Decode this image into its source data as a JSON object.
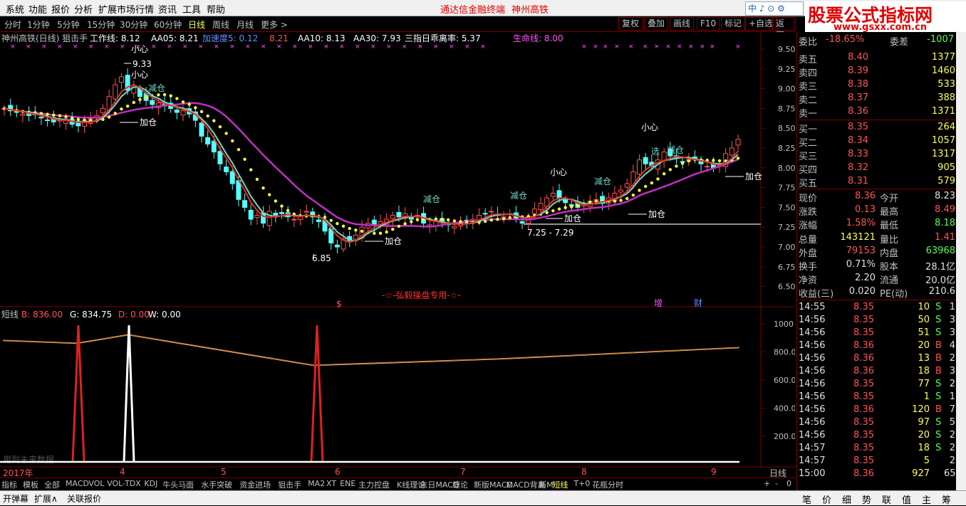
{
  "menu": {
    "items": [
      "系统",
      "功能",
      "报价",
      "分析",
      "扩展市场行情",
      "资讯",
      "工具",
      "帮助"
    ],
    "brand": "通达信金融终端",
    "stock_title": "神州高铁"
  },
  "watermark": {
    "title": "股票公式指标网",
    "url": "www.gsxx.com.cn"
  },
  "ime": {
    "text": "中 ♪ ⊙ ⚙"
  },
  "periods": {
    "items": [
      "分时",
      "1分钟",
      "5分钟",
      "15分钟",
      "30分钟",
      "60分钟",
      "日线",
      "周线",
      "月线",
      "更多 >"
    ],
    "active": "日线"
  },
  "toolbar": {
    "buttons": [
      "复权",
      "叠加",
      "画线",
      "F10",
      "标记",
      "+自选",
      "返回"
    ]
  },
  "indicator_line": {
    "title": "神州高铁(日线) 狙击手",
    "items": [
      {
        "label": "工作线: 8.12",
        "color": "#ffffff"
      },
      {
        "label": "AA05: 8.21",
        "color": "#ffffff"
      },
      {
        "label": "加速度5: 0.12",
        "color": "#5f8fff"
      },
      {
        "label": "8.21",
        "color": "#ff5454"
      },
      {
        "label": "AA10: 8.13",
        "color": "#ffffff"
      },
      {
        "label": "AA30: 7.93",
        "color": "#ffffff"
      },
      {
        "label": "三指日乖离率: 5.37",
        "color": "#ffffff"
      },
      {
        "label": "生命线: 8.00",
        "color": "#ff54ff"
      }
    ]
  },
  "price_axis": [
    "9.50",
    "9.25",
    "9.00",
    "8.75",
    "8.50",
    "8.25",
    "8.00",
    "7.75",
    "7.50",
    "7.25",
    "7.00",
    "6.75",
    "6.50"
  ],
  "annotations": {
    "high_label": "9.33",
    "low_label": "6.85",
    "range_label": "7.25 - 7.29",
    "jiacang": "加仓",
    "jiancang": "减仓",
    "xiaoxin": "小心",
    "xuan": "选",
    "banner": "-☆-弘毅操盘专用-☆-",
    "marker_s": "$",
    "marker_zeng": "增",
    "marker_cai": "财"
  },
  "sub_indicator": {
    "name": "短线",
    "b": "B: 836.00",
    "g": "G: 834.75",
    "d": "D: 0.00",
    "w": "W: 0.00",
    "axis": [
      "1000",
      "800.0",
      "600.0",
      "400.0",
      "200.0"
    ],
    "note": "用到未来数据"
  },
  "x_axis": {
    "labels": [
      "2017年",
      "4",
      "5",
      "6",
      "7",
      "8",
      "9"
    ],
    "period": "日线"
  },
  "tabs": {
    "items": [
      "指标",
      "模板",
      "全部",
      "MACD",
      "VOL",
      "VOL-TDX",
      "KDJ",
      "牛头马面",
      "水手突破",
      "资金进场",
      "狙击手",
      "MA2",
      "XT",
      "ENE",
      "主力控盘",
      "K线理论",
      "末日MACD",
      "缠论",
      "新版MACD",
      "MACD背离",
      "新M",
      "短线",
      "T+0",
      "花瓶分时"
    ],
    "active": "短线",
    "right": [
      "+",
      "-",
      "0"
    ]
  },
  "bottom": {
    "items": [
      "开弹幕",
      "扩展∧",
      "关联报价"
    ],
    "right": [
      "笔",
      "价",
      "细",
      "势",
      "联",
      "值",
      "主",
      "筹"
    ]
  },
  "quote": {
    "weibi": {
      "label": "委比",
      "value": "-18.65%",
      "diff_label": "委差",
      "diff": "-1007"
    },
    "sell": [
      {
        "label": "卖五",
        "price": "8.40",
        "vol": "1377"
      },
      {
        "label": "卖四",
        "price": "8.39",
        "vol": "1460"
      },
      {
        "label": "卖三",
        "price": "8.38",
        "vol": "533"
      },
      {
        "label": "卖二",
        "price": "8.37",
        "vol": "388"
      },
      {
        "label": "卖一",
        "price": "8.36",
        "vol": "1371"
      }
    ],
    "buy": [
      {
        "label": "买一",
        "price": "8.35",
        "vol": "264"
      },
      {
        "label": "买二",
        "price": "8.34",
        "vol": "1057"
      },
      {
        "label": "买三",
        "price": "8.33",
        "vol": "1317"
      },
      {
        "label": "买四",
        "price": "8.32",
        "vol": "905"
      },
      {
        "label": "买五",
        "price": "8.31",
        "vol": "579"
      }
    ],
    "stats": [
      {
        "l1": "现价",
        "v1": "8.36",
        "c1": "red",
        "l2": "今开",
        "v2": "8.23",
        "c2": "wht"
      },
      {
        "l1": "涨跌",
        "v1": "0.13",
        "c1": "red",
        "l2": "最高",
        "v2": "8.49",
        "c2": "red"
      },
      {
        "l1": "涨幅",
        "v1": "1.58%",
        "c1": "red",
        "l2": "最低",
        "v2": "8.18",
        "c2": "grn"
      },
      {
        "l1": "总量",
        "v1": "143121",
        "c1": "yel",
        "l2": "量比",
        "v2": "1.41",
        "c2": "red"
      },
      {
        "l1": "外盘",
        "v1": "79153",
        "c1": "red",
        "l2": "内盘",
        "v2": "63968",
        "c2": "grn"
      },
      {
        "l1": "换手",
        "v1": "0.71%",
        "c1": "wht",
        "l2": "股本",
        "v2": "28.1亿",
        "c2": "wht"
      },
      {
        "l1": "净资",
        "v1": "2.20",
        "c1": "wht",
        "l2": "流通",
        "v2": "20.0亿",
        "c2": "wht"
      },
      {
        "l1": "收益(三)",
        "v1": "0.020",
        "c1": "wht",
        "l2": "PE(动)",
        "v2": "210.6",
        "c2": "wht"
      }
    ],
    "ticks": [
      {
        "t": "14:55",
        "p": "8.35",
        "v": "10",
        "s": "S",
        "n": "1"
      },
      {
        "t": "14:56",
        "p": "8.35",
        "v": "50",
        "s": "S",
        "n": "3"
      },
      {
        "t": "14:56",
        "p": "8.35",
        "v": "51",
        "s": "S",
        "n": "3"
      },
      {
        "t": "14:56",
        "p": "8.36",
        "v": "20",
        "s": "B",
        "n": "4"
      },
      {
        "t": "14:56",
        "p": "8.36",
        "v": "13",
        "s": "B",
        "n": "2"
      },
      {
        "t": "14:56",
        "p": "8.36",
        "v": "18",
        "s": "B",
        "n": "3"
      },
      {
        "t": "14:56",
        "p": "8.35",
        "v": "77",
        "s": "S",
        "n": "2"
      },
      {
        "t": "14:56",
        "p": "8.35",
        "v": "1",
        "s": "S",
        "n": "1"
      },
      {
        "t": "14:56",
        "p": "8.36",
        "v": "120",
        "s": "B",
        "n": "7"
      },
      {
        "t": "14:56",
        "p": "8.35",
        "v": "97",
        "s": "S",
        "n": "5"
      },
      {
        "t": "14:56",
        "p": "8.35",
        "v": "20",
        "s": "S",
        "n": "2"
      },
      {
        "t": "14:57",
        "p": "8.35",
        "v": "18",
        "s": "S",
        "n": "2"
      },
      {
        "t": "14:57",
        "p": "8.35",
        "v": "5",
        "s": "",
        "n": "2"
      },
      {
        "t": "15:00",
        "p": "8.36",
        "v": "927",
        "s": "",
        "n": "65"
      }
    ]
  }
}
